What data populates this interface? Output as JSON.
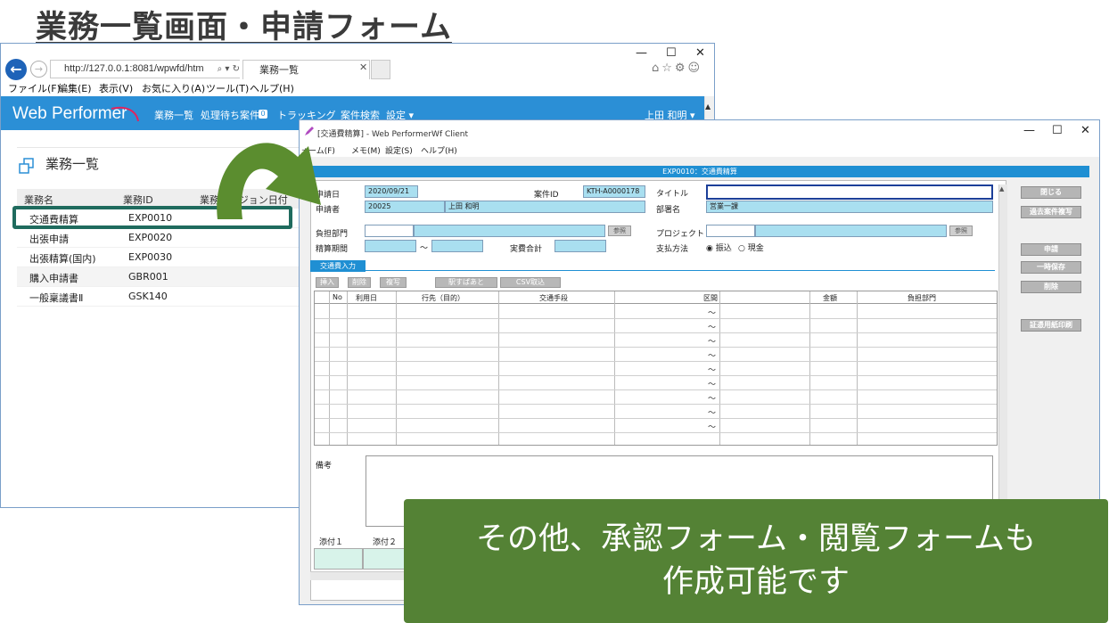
{
  "heading": "業務一覧画面・申請フォーム",
  "browser": {
    "address": "http://127.0.0.1:8081/wpwfd/html",
    "address_host": "127.0.0.1",
    "tab_title": "業務一覧",
    "menu": [
      "ファイル(F)",
      "編集(E)",
      "表示(V)",
      "お気に入り(A)",
      "ツール(T)",
      "ヘルプ(H)"
    ]
  },
  "webperformer": {
    "logo": "Web Performer",
    "nav": [
      "業務一覧",
      "処理待ち案件",
      "トラッキング",
      "案件検索",
      "設定 ▾"
    ],
    "pending_count": "0",
    "user": "上田 和明 ▾",
    "list_title": "業務一覧",
    "columns": [
      "業務名",
      "業務ID",
      "業務バージョン日付"
    ],
    "rows": [
      {
        "name": "交通費精算",
        "id": "EXP0010"
      },
      {
        "name": "出張申請",
        "id": "EXP0020"
      },
      {
        "name": "出張精算(国内)",
        "id": "EXP0030"
      },
      {
        "name": "購入申請書",
        "id": "GBR001"
      },
      {
        "name": "一般稟議書Ⅱ",
        "id": "GSK140"
      }
    ]
  },
  "client": {
    "window_title": "[交通費精算] - Web PerformerWf Client",
    "menu": [
      "ォーム(F)",
      "メモ(M)",
      "設定(S)",
      "ヘルプ(H)"
    ],
    "form_title": "EXP0010：交通費精算",
    "labels": {
      "date": "申請日",
      "applicant": "申請者",
      "case_id": "案件ID",
      "title": "タイトル",
      "dept": "部署名",
      "burden_dept": "負担部門",
      "project": "プロジェクト",
      "period": "精算期間",
      "total": "実費合計",
      "payment": "支払方法",
      "remarks": "備考",
      "attach1": "添付１",
      "attach2": "添付２"
    },
    "values": {
      "date": "2020/09/21",
      "applicant_id": "20025",
      "applicant_name": "上田 和明",
      "case_id": "KTH-A0000178",
      "title": "",
      "dept": "営業一課",
      "period_sep": "～"
    },
    "ref_button": "参照",
    "payment_options": [
      "◉ 振込",
      "○ 現金"
    ],
    "tab": "交通費入力",
    "grid_buttons": [
      "挿入",
      "削除",
      "複写",
      "駅すぱあと",
      "CSV取込"
    ],
    "grid_columns": [
      "No",
      "利用日",
      "行先（目的）",
      "交通手段",
      "区間",
      "金額",
      "負担部門"
    ],
    "grid_tilde": "～",
    "side_buttons": [
      "閉じる",
      "過去案件複写",
      "申請",
      "一時保存",
      "削除",
      "証憑用紙印刷"
    ]
  },
  "callout": {
    "line1": "その他、承認フォーム・閲覧フォームも",
    "line2": "作成可能です"
  },
  "colors": {
    "header_blue": "#2b8fd6",
    "field_blue": "#a9dff0",
    "highlight": "#1f6b5e",
    "callout_green": "#548235",
    "arrow_green": "#5b8d2f"
  }
}
